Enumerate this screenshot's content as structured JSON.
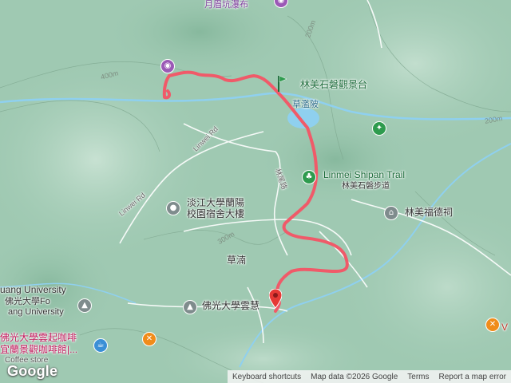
{
  "map": {
    "labels": {
      "waterfall": "月眉坑瀑布",
      "viewpoint": "林美石磐觀景台",
      "pond": "草濫陂",
      "trail_en": "Linmei Shipan Trail",
      "trail_zh": "林美石磐步道",
      "linwei_rd_1": "Linwei Rd",
      "linwei_rd_2": "Linwei Rd",
      "linmei_rd": "林尾路",
      "dorm_line1": "淡江大學蘭陽",
      "dorm_line2": "校園宿舍大樓",
      "fude_temple": "林美福德祠",
      "caonan": "草湳",
      "univ_en": "uang University",
      "univ_zh": "佛光大學Fo",
      "univ_en2": "ang University",
      "yunhui": "佛光大學雲慧",
      "cafe1": "佛光大學雲起咖啡",
      "cafe2": "宜蘭景觀咖啡館|...",
      "coffee_store": "Coffee store",
      "contour_400": "400m",
      "contour_300": "300m",
      "contour_200a": "200m",
      "contour_200b": "200m",
      "right_edge": "V"
    },
    "icons": {
      "camera": "camera-icon",
      "flag": "green-flag-icon",
      "end_marker": "red-pin-icon",
      "hiking": "hiking-icon",
      "tree": "tree-icon",
      "temple": "temple-icon",
      "university": "graduation-cap-icon",
      "food": "fork-knife-icon",
      "cafe": "cafe-icon",
      "place": "place-dot-icon"
    },
    "colors": {
      "route": "#f05a69",
      "terrain": "#9fc9b2",
      "water": "#8fd0ef",
      "road": "#ffffff"
    }
  },
  "footer": {
    "logo": "Google",
    "keyboard": "Keyboard shortcuts",
    "map_data": "Map data ©2026 Google",
    "terms": "Terms",
    "report": "Report a map error"
  }
}
